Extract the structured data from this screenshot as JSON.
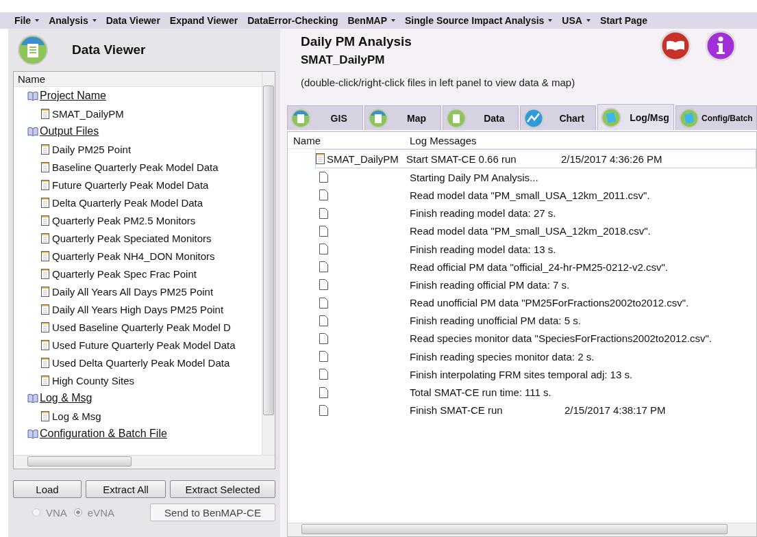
{
  "menu": [
    {
      "label": "File",
      "dropdown": true
    },
    {
      "label": "Analysis",
      "dropdown": true
    },
    {
      "label": "Data Viewer",
      "dropdown": false
    },
    {
      "label": "Expand Viewer",
      "dropdown": false
    },
    {
      "label": "DataError-Checking",
      "dropdown": false
    },
    {
      "label": "BenMAP",
      "dropdown": true
    },
    {
      "label": "Single Source Impact Analysis",
      "dropdown": true
    },
    {
      "label": "USA",
      "dropdown": true
    },
    {
      "label": "Start Page",
      "dropdown": false
    }
  ],
  "sidebar": {
    "title": "Data Viewer",
    "tree_header": "Name",
    "tree": [
      {
        "label": "Project Name",
        "children": [
          {
            "label": "SMAT_DailyPM"
          }
        ]
      },
      {
        "label": "Output Files",
        "children": [
          {
            "label": "Daily PM25 Point"
          },
          {
            "label": "Baseline Quarterly Peak Model Data"
          },
          {
            "label": "Future Quarterly Peak Model Data"
          },
          {
            "label": "Delta Quarterly Peak Model Data"
          },
          {
            "label": "Quarterly Peak PM2.5 Monitors"
          },
          {
            "label": "Quarterly Peak Speciated Monitors"
          },
          {
            "label": "Quarterly Peak NH4_DON Monitors"
          },
          {
            "label": "Quarterly Peak Spec Frac Point"
          },
          {
            "label": "Daily All Years All Days PM25 Point"
          },
          {
            "label": "Daily All Years High Days PM25 Point"
          },
          {
            "label": "Used Baseline Quarterly Peak Model D"
          },
          {
            "label": "Used Future Quarterly Peak Model Data"
          },
          {
            "label": "Used Delta Quarterly Peak Model Data"
          },
          {
            "label": "High County Sites"
          }
        ]
      },
      {
        "label": "Log & Msg",
        "children": [
          {
            "label": "Log & Msg"
          }
        ]
      },
      {
        "label": "Configuration & Batch File"
      }
    ],
    "buttons": [
      "Load",
      "Extract All",
      "Extract Selected"
    ],
    "radios": [
      {
        "label": "VNA",
        "selected": false
      },
      {
        "label": "eVNA",
        "selected": true
      }
    ],
    "send_button": "Send to BenMAP-CE"
  },
  "main": {
    "title": "Daily PM Analysis",
    "subtitle": "SMAT_DailyPM",
    "hint": "(double-click/right-click files in left panel to view data & map)",
    "tabs": [
      {
        "label": "GIS",
        "kind": "globe",
        "selected": false
      },
      {
        "label": "Map",
        "kind": "globe",
        "selected": false
      },
      {
        "label": "Data",
        "kind": "sheet",
        "selected": false
      },
      {
        "label": "Chart",
        "kind": "chart",
        "selected": false
      },
      {
        "label": "Log/Msg",
        "kind": "note",
        "selected": true
      },
      {
        "label": "Config/Batch",
        "kind": "note",
        "selected": false
      }
    ],
    "columns": [
      "Name",
      "Log Messages"
    ],
    "rows": [
      {
        "kind": "file",
        "name": "SMAT_DailyPM",
        "message": "Start SMAT-CE 0.66 run",
        "time": "2/15/2017 4:36:26 PM"
      },
      {
        "kind": "entry",
        "message": "Starting Daily PM Analysis..."
      },
      {
        "kind": "entry",
        "message": "Read model data \"PM_small_USA_12km_2011.csv\"."
      },
      {
        "kind": "entry",
        "message": "Finish reading model data: 27 s."
      },
      {
        "kind": "entry",
        "message": "Read model data \"PM_small_USA_12km_2018.csv\"."
      },
      {
        "kind": "entry",
        "message": "Finish reading model data: 13 s."
      },
      {
        "kind": "entry",
        "message": "Read official PM data \"official_24-hr-PM25-0212-v2.csv\"."
      },
      {
        "kind": "entry",
        "message": "Finish reading official PM data: 7 s."
      },
      {
        "kind": "entry",
        "message": "Read unofficial PM data \"PM25ForFractions2002to2012.csv\"."
      },
      {
        "kind": "entry",
        "message": "Finish reading unofficial PM data: 5 s."
      },
      {
        "kind": "entry",
        "message": "Read species monitor data \"SpeciesForFractions2002to2012.csv\"."
      },
      {
        "kind": "entry",
        "message": "Finish reading species monitor data: 2 s."
      },
      {
        "kind": "entry",
        "message": "Finish interpolating FRM sites temporal adj: 13 s."
      },
      {
        "kind": "entry",
        "message": "Total SMAT-CE run time: 111 s."
      },
      {
        "kind": "entry",
        "message": "Finish SMAT-CE run",
        "time": "2/15/2017 4:38:17 PM"
      }
    ]
  }
}
